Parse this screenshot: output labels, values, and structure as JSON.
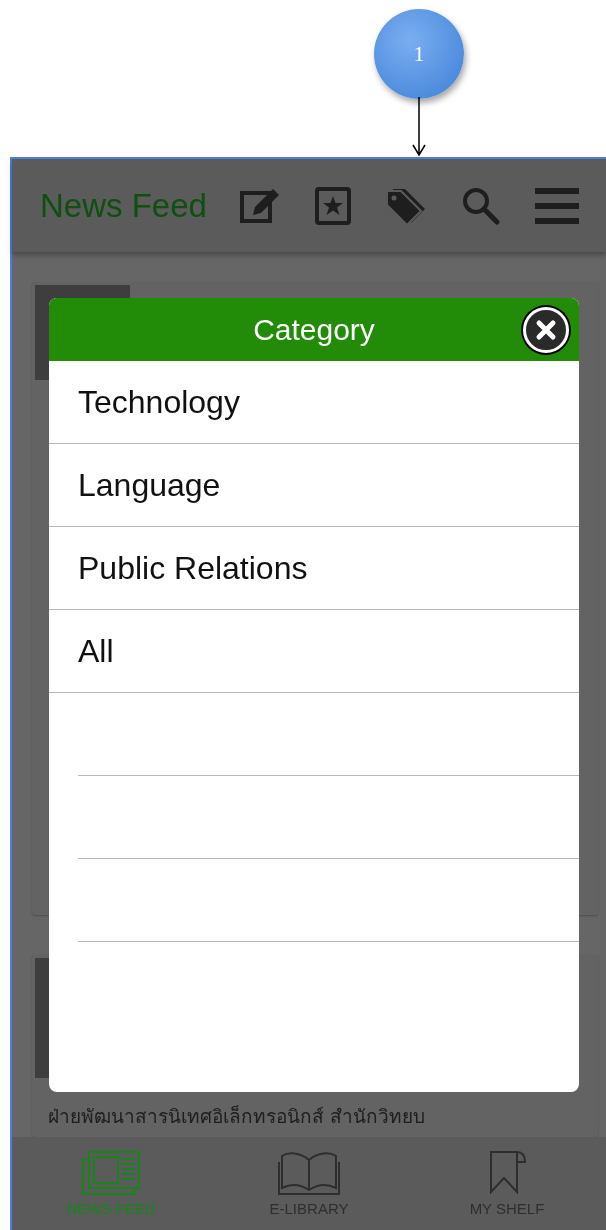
{
  "callout": {
    "number": "1"
  },
  "header": {
    "title": "News Feed"
  },
  "feed": {
    "snippet": "ฝ่ายพัฒนาสารนิเทศอิเล็กทรอนิกส์ สำนักวิทยบ"
  },
  "modal": {
    "title": "Category",
    "items": [
      {
        "label": "Technology"
      },
      {
        "label": "Language"
      },
      {
        "label": "Public Relations"
      },
      {
        "label": "All"
      }
    ]
  },
  "tabs": [
    {
      "label": "NEWS FEED",
      "kind": "news",
      "selected": true
    },
    {
      "label": "E-LIBRARY",
      "kind": "library",
      "selected": false
    },
    {
      "label": "MY SHELF",
      "kind": "shelf",
      "selected": false
    }
  ]
}
